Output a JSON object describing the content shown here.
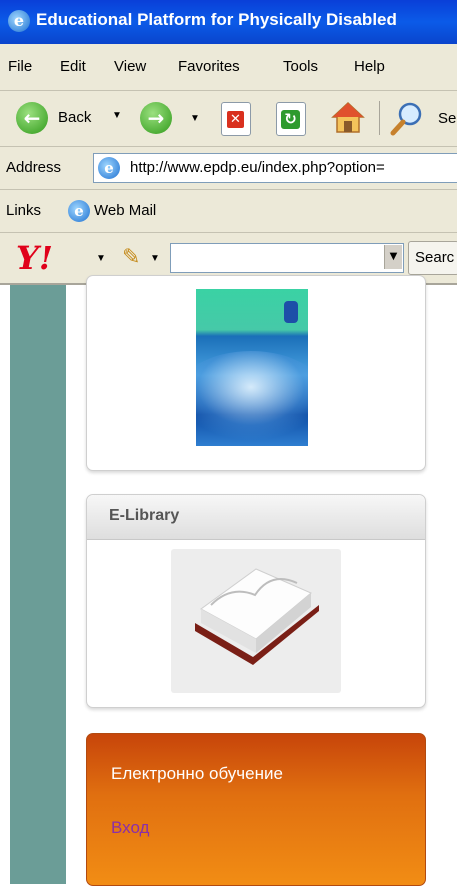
{
  "window": {
    "title": "Educational Platform for Physically Disabled"
  },
  "menu": {
    "items": [
      "File",
      "Edit",
      "View",
      "Favorites",
      "Tools",
      "Help"
    ]
  },
  "toolbar": {
    "back_label": "Back",
    "search_partial": "Se"
  },
  "address": {
    "label": "Address",
    "url": "http://www.epdp.eu/index.php?option="
  },
  "links": {
    "label": "Links",
    "web_mail": "Web Mail"
  },
  "yahoo": {
    "logo": "Y!",
    "search_partial": "Searc",
    "input_value": ""
  },
  "content": {
    "elibrary": {
      "title": "E-Library"
    },
    "elearning": {
      "title": "Електронно обучение",
      "login_link": "Вход"
    }
  }
}
